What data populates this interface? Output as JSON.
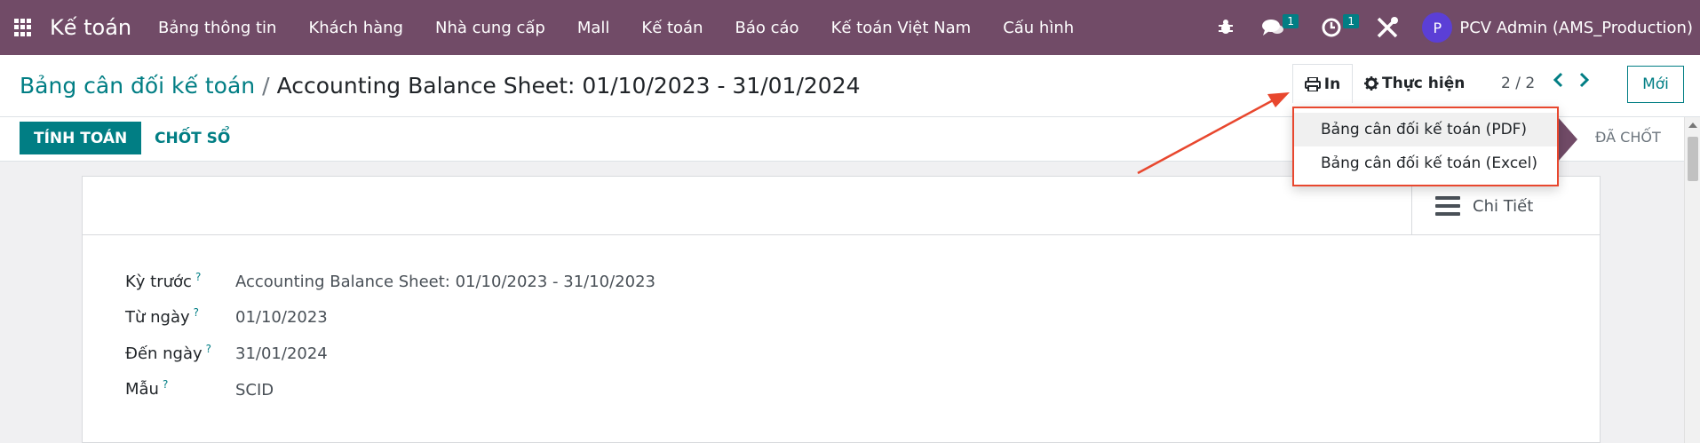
{
  "navbar": {
    "brand": "Kế toán",
    "menu": [
      "Bảng thông tin",
      "Khách hàng",
      "Nhà cung cấp",
      "Mall",
      "Kế toán",
      "Báo cáo",
      "Kế toán Việt Nam",
      "Cấu hình"
    ],
    "messages_count": "1",
    "activities_count": "1",
    "avatar_letter": "P",
    "user": "PCV Admin (AMS_Production)"
  },
  "control_panel": {
    "breadcrumb_parent": "Bảng cân đối kế toán",
    "breadcrumb_separator": "/",
    "breadcrumb_current": "Accounting Balance Sheet: 01/10/2023 - 31/01/2024",
    "print_label": "In",
    "action_label": "Thực hiện",
    "pager": "2 / 2",
    "new_label": "Mới"
  },
  "print_menu": {
    "items": [
      "Bảng cân đối kế toán (PDF)",
      "Bảng cân đối kế toán (Excel)"
    ]
  },
  "statusbar": {
    "compute_label": "TÍNH TOÁN",
    "close_label": "CHỐT SỔ",
    "stage_done": "ĐÃ CHỐT"
  },
  "form": {
    "detail_tab": "Chi Tiết",
    "fields": [
      {
        "label": "Kỳ trước",
        "value": "Accounting Balance Sheet: 01/10/2023 - 31/10/2023"
      },
      {
        "label": "Từ ngày",
        "value": "01/10/2023"
      },
      {
        "label": "Đến ngày",
        "value": "31/01/2024"
      },
      {
        "label": "Mẫu",
        "value": "SCID"
      }
    ],
    "help_mark": "?"
  },
  "colors": {
    "navbar": "#714b67",
    "primary": "#017e84",
    "highlight_border": "#e8472e"
  }
}
